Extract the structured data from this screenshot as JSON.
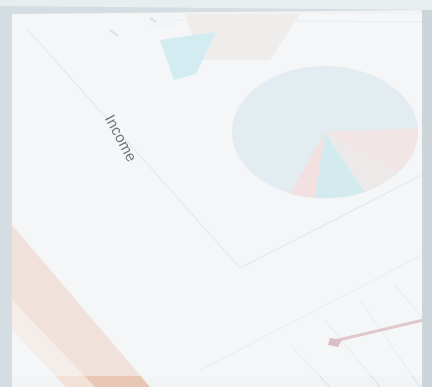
{
  "photo": {
    "subject": "printed-report-with-pie-chart",
    "printed_label": "Income",
    "colors": {
      "paper": "#f2f5f6",
      "pie_main": "#c9dde6",
      "pie_pink": "#e7c9c8",
      "pie_teal": "#a9dbe0",
      "pie_rose": "#efc3c3",
      "bar_teal": "#8fd3df",
      "pencil": "#e8c6b4",
      "pen_tip": "#c48c90",
      "overlay": "#f6f8f9"
    }
  }
}
